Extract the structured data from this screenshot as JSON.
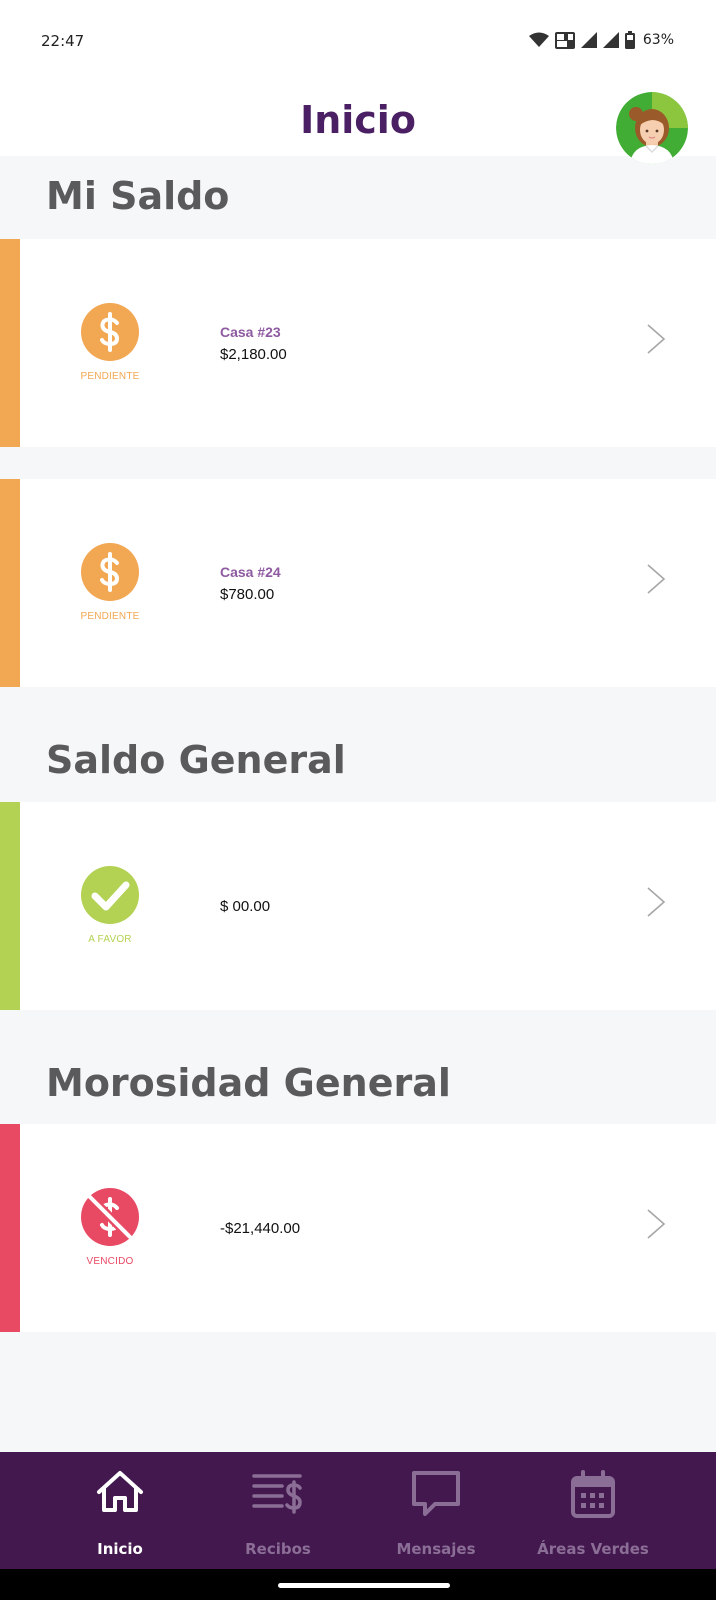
{
  "status_bar": {
    "time": "22:47",
    "battery": "63%",
    "icons": [
      "wifi-icon",
      "volte-icon",
      "signal-icon",
      "signal-icon",
      "battery-icon"
    ]
  },
  "header": {
    "title": "Inicio",
    "avatar_icon": "user-avatar-icon"
  },
  "colors": {
    "brand_purple": "#43184f",
    "pending_orange": "#f2a752",
    "favor_green": "#b3d152",
    "overdue_red": "#e84a64",
    "house_label_purple": "#8e5aa0"
  },
  "sections": {
    "mi_saldo": {
      "title": "Mi Saldo",
      "cards": [
        {
          "house": "Casa #23",
          "amount": "$2,180.00",
          "status": "PENDIENTE",
          "icon": "dollar-icon"
        },
        {
          "house": "Casa #24",
          "amount": "$780.00",
          "status": "PENDIENTE",
          "icon": "dollar-icon"
        }
      ]
    },
    "saldo_general": {
      "title": "Saldo General",
      "card": {
        "amount": "$ 00.00",
        "status": "A FAVOR",
        "icon": "check-icon"
      }
    },
    "morosidad_general": {
      "title": "Morosidad General",
      "card": {
        "amount": "-$21,440.00",
        "status": "VENCIDO",
        "icon": "no-dollar-icon"
      }
    }
  },
  "bottom_nav": {
    "items": [
      {
        "label": "Inicio",
        "icon": "home-icon",
        "active": true
      },
      {
        "label": "Recibos",
        "icon": "receipts-icon",
        "active": false
      },
      {
        "label": "Mensajes",
        "icon": "message-icon",
        "active": false
      },
      {
        "label": "Áreas Verdes",
        "icon": "calendar-icon",
        "active": false
      }
    ]
  }
}
